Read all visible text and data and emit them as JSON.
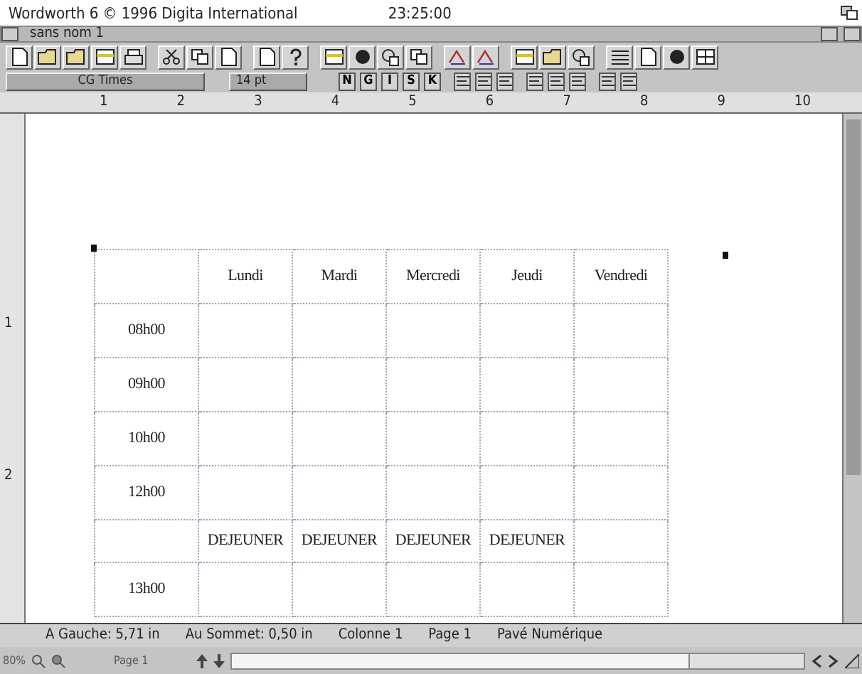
{
  "screen_title": {
    "app": "Wordworth 6  © 1996 Digita International",
    "clock": "23:25:00"
  },
  "window": {
    "title": "sans nom 1"
  },
  "format_bar": {
    "font": "CG Times",
    "size": "14 pt",
    "style_buttons": [
      "N",
      "G",
      "I",
      "S",
      "K"
    ]
  },
  "ruler": {
    "numbers": [
      "1",
      "2",
      "3",
      "4",
      "5",
      "6",
      "7",
      "8",
      "9",
      "10"
    ]
  },
  "vertical_ruler": {
    "numbers": [
      "1",
      "2"
    ]
  },
  "table": {
    "columns": [
      "Lundi",
      "Mardi",
      "Mercredi",
      "Jeudi",
      "Vendredi"
    ],
    "rows": [
      {
        "kind": "time",
        "label": "08h00"
      },
      {
        "kind": "time",
        "label": "09h00"
      },
      {
        "kind": "time",
        "label": "10h00"
      },
      {
        "kind": "time",
        "label": "12h00"
      },
      {
        "kind": "break",
        "cells": [
          "DEJEUNER",
          "DEJEUNER",
          "DEJEUNER",
          "DEJEUNER"
        ]
      },
      {
        "kind": "time",
        "label": "13h00"
      }
    ]
  },
  "status_bar": {
    "items": [
      "A Gauche: 5,71 in",
      "Au Sommet: 0,50 in",
      "Colonne 1",
      "Page 1",
      "Pavé Numérique"
    ]
  },
  "bottom_bar": {
    "zoom": "80%",
    "page": "Page 1"
  }
}
